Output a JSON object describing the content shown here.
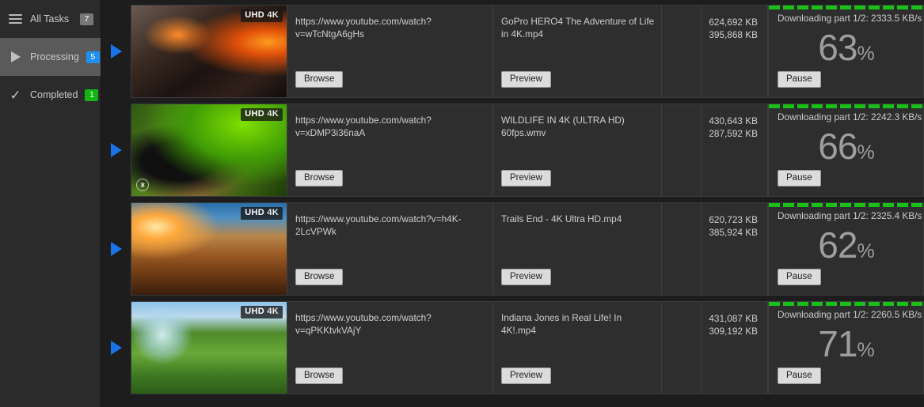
{
  "sidebar": {
    "items": [
      {
        "label": "All Tasks",
        "badge": "7",
        "badge_color": "#777777",
        "icon": "hamburger-icon",
        "selected": false
      },
      {
        "label": "Processing",
        "badge": "5",
        "badge_color": "#1e90f0",
        "icon": "play-icon",
        "selected": true
      },
      {
        "label": "Completed",
        "badge": "1",
        "badge_color": "#12b512",
        "icon": "check-icon",
        "selected": false
      }
    ]
  },
  "buttons": {
    "browse": "Browse",
    "preview": "Preview",
    "pause": "Pause"
  },
  "badge_text": {
    "uhd": "UHD",
    "k4": "4K"
  },
  "colors": {
    "progress_green": "#18c018",
    "accent_blue": "#1a74e8",
    "panel": "#2e2e2e",
    "app_bg": "#1d1d1d"
  },
  "tasks": [
    {
      "url": "https://www.youtube.com/watch?v=wTcNtgA6gHs",
      "filename": "GoPro HERO4  The Adventure of Life in 4K.mp4",
      "size_total": "624,692 KB",
      "size_done": "395,868 KB",
      "status": "Downloading part 1/2: 2333.5 KB/s",
      "percent": "63",
      "percent_symbol": "%",
      "quality": "UHD 4K",
      "thumbnail": "lava-volcano-thumbnail",
      "has_watermark": false
    },
    {
      "url": "https://www.youtube.com/watch?v=xDMP3i36naA",
      "filename": "WILDLIFE IN 4K (ULTRA HD) 60fps.wmv",
      "size_total": "430,643 KB",
      "size_done": "287,592 KB",
      "status": "Downloading part 1/2: 2242.3 KB/s",
      "percent": "66",
      "percent_symbol": "%",
      "quality": "UHD 4K",
      "thumbnail": "hornbill-bird-thumbnail",
      "has_watermark": true
    },
    {
      "url": "https://www.youtube.com/watch?v=h4K-2LcVPWk",
      "filename": "Trails End - 4K Ultra HD.mp4",
      "size_total": "620,723 KB",
      "size_done": "385,924 KB",
      "status": "Downloading part 1/2: 2325.4 KB/s",
      "percent": "62",
      "percent_symbol": "%",
      "quality": "UHD 4K",
      "thumbnail": "canyon-sunset-thumbnail",
      "has_watermark": false
    },
    {
      "url": "https://www.youtube.com/watch?v=qPKKtvkVAjY",
      "filename": "Indiana Jones in Real Life! In 4K!.mp4",
      "size_total": "431,087 KB",
      "size_done": "309,192 KB",
      "status": "Downloading part 1/2: 2260.5 KB/s",
      "percent": "71",
      "percent_symbol": "%",
      "quality": "UHD 4K",
      "thumbnail": "zorb-ball-hill-thumbnail",
      "has_watermark": false
    }
  ]
}
